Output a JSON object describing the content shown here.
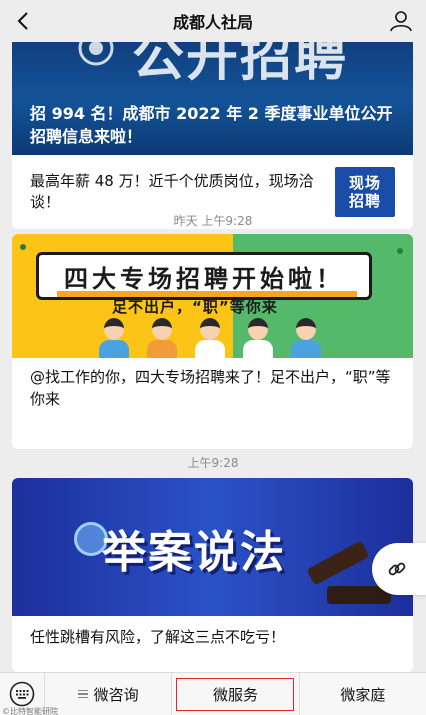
{
  "header": {
    "title": "成都人社局",
    "back_icon": "chevron-left-icon",
    "profile_icon": "person-icon"
  },
  "feed": {
    "cards": [
      {
        "banner_text": "公开招聘",
        "headline": "招 994 名！成都市 2022 年 2 季度事业单位公开招聘信息来啦！",
        "summary": "最高年薪 48 万！近千个优质岗位，现场洽谈！",
        "thumb_line1": "现场",
        "thumb_line2": "招聘"
      },
      {
        "timestamp": "昨天 上午9:28",
        "banner_title": "四大专场招聘开始啦！",
        "banner_sub": "足不出户，“职”等你来",
        "caption": "@找工作的你，四大专场招聘来了！足不出户，“职”等你来"
      },
      {
        "timestamp": "上午9:28",
        "banner_title": "举案说法",
        "caption": "任性跳槽有风险，了解这三点不吃亏！"
      }
    ]
  },
  "float_button": {
    "icon": "link-icon"
  },
  "tabbar": {
    "keyboard_icon": "keyboard-icon",
    "tabs": [
      {
        "label": "微咨询",
        "has_menu_icon": true
      },
      {
        "label": "微服务",
        "active": true
      },
      {
        "label": "微家庭"
      }
    ]
  },
  "watermark": "©比特智能研院"
}
